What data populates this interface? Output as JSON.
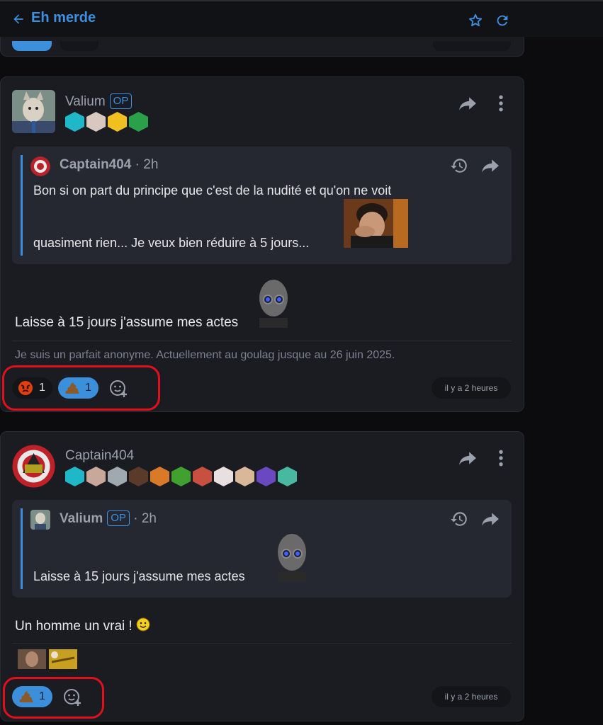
{
  "topbar": {
    "title": "Eh merde",
    "back_icon": "arrow-left-icon",
    "star_icon": "star-icon",
    "refresh_icon": "refresh-icon"
  },
  "colors": {
    "accent": "#3d8fe0",
    "card": "#1b1c22",
    "quote": "#262831",
    "highlight": "#e0101c"
  },
  "posts": [
    {
      "author": "Valium",
      "op_label": "OP",
      "quote": {
        "author": "Captain404",
        "time": "· 2h",
        "line1": "Bon si on part du principe que c'est de la nudité et qu'on ne voit",
        "line2": "quasiment rien... Je veux bien réduire à 5 jours..."
      },
      "body": "Laisse à 15 jours j'assume mes actes",
      "signature": "Je suis un parfait anonyme. Actuellement au goulag jusque au 26 juin 2025.",
      "reactions": [
        {
          "icon": "angry-face-icon",
          "count": "1"
        },
        {
          "icon": "poop-icon",
          "count": "1"
        }
      ],
      "timestamp": "il y a 2 heures"
    },
    {
      "author": "Captain404",
      "quote": {
        "author": "Valium",
        "op_label": "OP",
        "time": "· 2h",
        "line1": "Laisse à 15 jours j'assume mes actes"
      },
      "body": "Un homme un vrai !",
      "reactions": [
        {
          "icon": "poop-icon",
          "count": "1"
        }
      ],
      "timestamp": "il y a 2 heures"
    }
  ]
}
